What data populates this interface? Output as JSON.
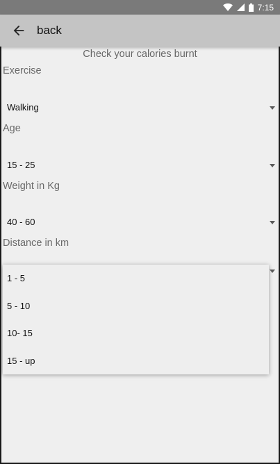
{
  "status_bar": {
    "time": "7:15",
    "icons": [
      "wifi-icon",
      "signal-icon",
      "battery-icon"
    ]
  },
  "app_bar": {
    "title": "back",
    "back_icon": "arrow-back-icon"
  },
  "form": {
    "heading": "Check your calories burnt",
    "exercise": {
      "label": "Exercise",
      "value": "Walking"
    },
    "age": {
      "label": "Age",
      "value": "15 - 25"
    },
    "weight": {
      "label": "Weight in Kg",
      "value": "40 - 60"
    },
    "distance": {
      "label": "Distance in km"
    }
  },
  "distance_dropdown": {
    "options": [
      "1 - 5",
      "5 - 10",
      "10- 15",
      "15 - up"
    ]
  },
  "colors": {
    "status_bar": "#7a7a7a",
    "app_bar": "#c4c4c4",
    "background": "#efefef"
  }
}
